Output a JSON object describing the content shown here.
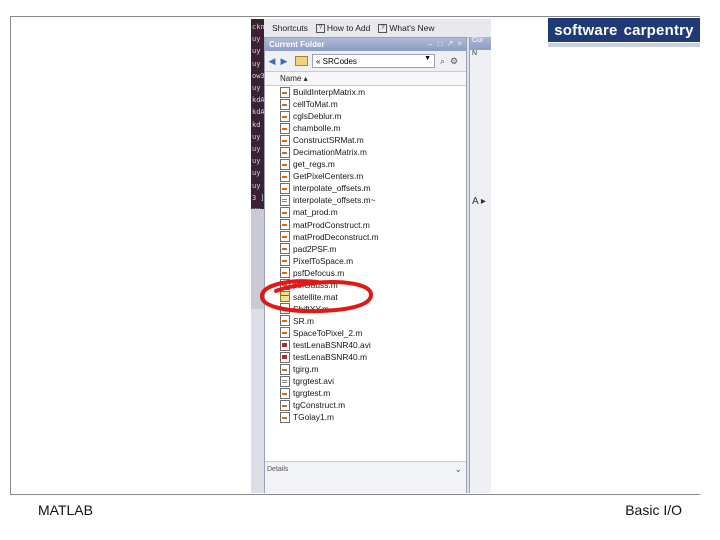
{
  "footer": {
    "left": "MATLAB",
    "right": "Basic I/O"
  },
  "logo": {
    "word1": "software",
    "word2": "carpentry"
  },
  "terminal": {
    "lines": [
      "ckn",
      "uy r",
      "uy r",
      "uy r",
      "ow3",
      "uy r",
      "kdA",
      "kdA",
      "kd ]",
      "uy r",
      "uy r",
      "uy r",
      "uy r",
      "uy r",
      "3 ]",
      "uy r"
    ]
  },
  "toolbar": {
    "shortcuts_label": "Shortcuts",
    "howto_label": "How to Add",
    "whats_new_label": "What's New"
  },
  "panel": {
    "title": "Current Folder",
    "controls": [
      "→",
      "□",
      "↗",
      "×"
    ],
    "path": "« SRCodes",
    "column_header": "Name ▴",
    "details_label": "Details"
  },
  "right_panel": {
    "title": "Cur",
    "nav": "N"
  },
  "side_label": "A ▸",
  "files": [
    {
      "name": "BuildInterpMatrix.m",
      "type": "m"
    },
    {
      "name": "cellToMat.m",
      "type": "m"
    },
    {
      "name": "cglsDeblur.m",
      "type": "m"
    },
    {
      "name": "chambolle.m",
      "type": "m"
    },
    {
      "name": "ConstructSRMat.m",
      "type": "m"
    },
    {
      "name": "DecimationMatrix.m",
      "type": "m"
    },
    {
      "name": "get_regs.m",
      "type": "m"
    },
    {
      "name": "GetPixelCenters.m",
      "type": "m"
    },
    {
      "name": "interpolate_offsets.m",
      "type": "m"
    },
    {
      "name": "interpolate_offsets.m~",
      "type": "txt"
    },
    {
      "name": "mat_prod.m",
      "type": "m"
    },
    {
      "name": "matProdConstruct.m",
      "type": "m"
    },
    {
      "name": "matProdDeconstruct.m",
      "type": "m"
    },
    {
      "name": "pad2PSF.m",
      "type": "m"
    },
    {
      "name": "PixelToSpace.m",
      "type": "m"
    },
    {
      "name": "psfDefocus.m",
      "type": "m"
    },
    {
      "name": "psfGauss.m",
      "type": "m"
    },
    {
      "name": "satellite.mat",
      "type": "mat"
    },
    {
      "name": "ShiftXY.m",
      "type": "m"
    },
    {
      "name": "SR.m",
      "type": "m"
    },
    {
      "name": "SpaceToPixel_2.m",
      "type": "m"
    },
    {
      "name": "testLenaBSNR40.avi",
      "type": "avi"
    },
    {
      "name": "testLenaBSNR40.m",
      "type": "avi"
    },
    {
      "name": "tgirg.m",
      "type": "m"
    },
    {
      "name": "tgrgtest.avi",
      "type": "txt"
    },
    {
      "name": "tgrgtest.m",
      "type": "m"
    },
    {
      "name": "tgConstruct.m",
      "type": "m"
    },
    {
      "name": "TGolay1.m",
      "type": "m"
    }
  ],
  "colors": {
    "logo_bg": "#1f3a74",
    "annotation": "#e01818",
    "panel_title": "#8c9cc4"
  }
}
